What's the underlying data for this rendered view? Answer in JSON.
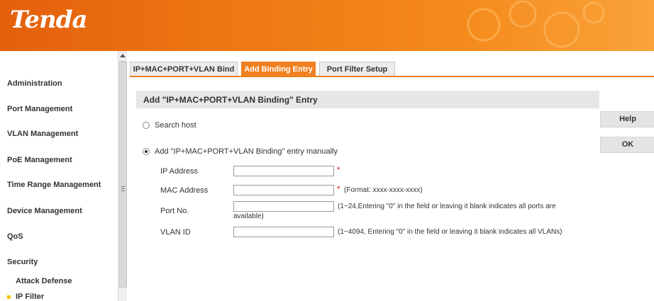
{
  "header": {
    "logo_text": "Tenda"
  },
  "sidebar": {
    "items": [
      {
        "label": "Administration"
      },
      {
        "label": "Port Management"
      },
      {
        "label": "VLAN Management"
      },
      {
        "label": "PoE Management"
      },
      {
        "label": "Time Range Management"
      },
      {
        "label": "Device Management"
      },
      {
        "label": "QoS"
      },
      {
        "label": "Security"
      }
    ],
    "subitems": [
      {
        "label": "Attack Defense"
      },
      {
        "label": "IP Filter"
      }
    ]
  },
  "tabs": [
    {
      "label": "IP+MAC+PORT+VLAN Bind",
      "active": false
    },
    {
      "label": "Add Binding Entry",
      "active": true
    },
    {
      "label": "Port Filter Setup",
      "active": false
    }
  ],
  "section": {
    "title": "Add \"IP+MAC+PORT+VLAN Binding\" Entry"
  },
  "buttons": {
    "help": "Help",
    "ok": "OK"
  },
  "options": {
    "search_host": "Search host",
    "manual": "Add \"IP+MAC+PORT+VLAN Binding\" entry manually",
    "selected": "manual"
  },
  "form": {
    "ip": {
      "label": "IP Address",
      "value": "",
      "required_mark": "*"
    },
    "mac": {
      "label": "MAC Address",
      "value": "",
      "required_mark": "*",
      "hint": "(Format: xxxx-xxxx-xxxx)"
    },
    "port": {
      "label": "Port No.",
      "value": "",
      "hint_line1": "(1~24,Entering \"0\" in the field or leaving it blank indicates all ports are",
      "hint_line2": "available)"
    },
    "vlan": {
      "label": "VLAN ID",
      "value": "",
      "hint": "(1~4094, Entering \"0\" in the field or leaving it blank indicates all VLANs)"
    }
  },
  "colors": {
    "accent": "#f08020",
    "header_start": "#e4600c",
    "header_end": "#f9a33a"
  }
}
